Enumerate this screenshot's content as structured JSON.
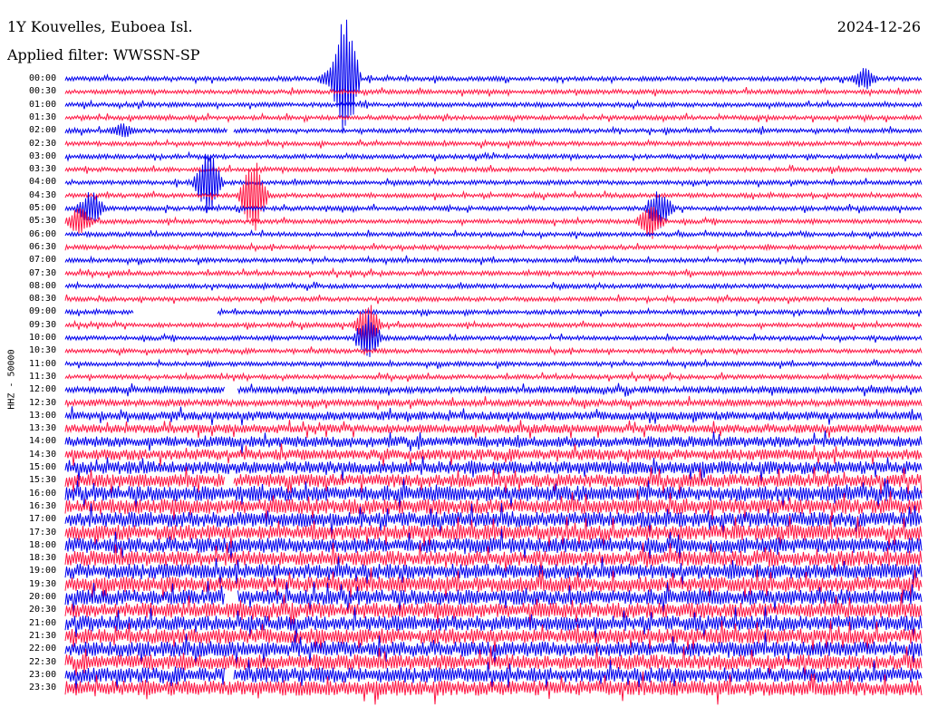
{
  "header": {
    "title": "1Y Kouvelles, Euboea Isl.",
    "date": "2024-12-26",
    "filter": "Applied filter: WWSSN-SP",
    "channel_label": "HHZ - 50000"
  },
  "colors": {
    "trace_a": "#0000ee",
    "trace_b": "#ff1744",
    "background": "#ffffff"
  },
  "chart_data": {
    "type": "line",
    "title": "1Y Kouvelles, Euboea Isl.",
    "subtitle": "Applied filter: WWSSN-SP",
    "ylabel": "HHZ - 50000",
    "row_labels": [
      "00:00",
      "00:30",
      "01:00",
      "01:30",
      "02:00",
      "02:30",
      "03:00",
      "03:30",
      "04:00",
      "04:30",
      "05:00",
      "05:30",
      "06:00",
      "06:30",
      "07:00",
      "07:30",
      "08:00",
      "08:30",
      "09:00",
      "09:30",
      "10:00",
      "10:30",
      "11:00",
      "11:30",
      "12:00",
      "12:30",
      "13:00",
      "13:30",
      "14:00",
      "14:30",
      "15:00",
      "15:30",
      "16:00",
      "16:30",
      "17:00",
      "17:30",
      "18:00",
      "18:30",
      "19:00",
      "19:30",
      "20:00",
      "20:30",
      "21:00",
      "21:30",
      "22:00",
      "22:30",
      "23:00",
      "23:30"
    ],
    "row_colors": [
      "blue",
      "red"
    ],
    "noise_level": [
      2,
      2,
      2,
      2,
      2,
      2,
      2,
      2,
      2,
      2,
      2,
      2,
      2,
      2,
      2,
      2,
      2,
      2,
      2,
      2,
      2,
      2,
      2,
      2,
      3,
      3,
      4,
      4,
      5,
      5,
      6,
      6,
      7,
      7,
      7,
      7,
      7,
      7,
      7,
      7,
      7,
      7,
      7,
      7,
      7,
      7,
      7,
      7
    ],
    "gaps": [
      {
        "row": "02:00",
        "from_min": 5.7,
        "to_min": 5.9
      },
      {
        "row": "09:00",
        "from_min": 2.4,
        "to_min": 5.3
      },
      {
        "row": "12:00",
        "from_min": 5.6,
        "to_min": 6.0
      },
      {
        "row": "15:30",
        "from_min": 5.6,
        "to_min": 5.9
      },
      {
        "row": "20:00",
        "from_min": 5.6,
        "to_min": 6.0
      },
      {
        "row": "23:00",
        "from_min": 5.6,
        "to_min": 5.9
      }
    ],
    "events": [
      {
        "row": "00:00",
        "minute": 9.3,
        "amplitude": 14
      },
      {
        "row": "00:00",
        "minute": 28.0,
        "amplitude": 14
      },
      {
        "row": "02:00",
        "minute": 2.0,
        "amplitude": 10
      },
      {
        "row": "04:00",
        "minute": 5.0,
        "amplitude": 40
      },
      {
        "row": "04:30",
        "minute": 6.6,
        "amplitude": 45
      },
      {
        "row": "05:00",
        "minute": 0.9,
        "amplitude": 22
      },
      {
        "row": "05:00",
        "minute": 20.8,
        "amplitude": 25
      },
      {
        "row": "05:30",
        "minute": 0.5,
        "amplitude": 18
      },
      {
        "row": "05:30",
        "minute": 20.5,
        "amplitude": 22
      },
      {
        "row": "09:30",
        "minute": 10.6,
        "amplitude": 30
      },
      {
        "row": "10:00",
        "minute": 10.6,
        "amplitude": 28
      },
      {
        "row": "00:00",
        "minute": 9.8,
        "amplitude": 80
      }
    ]
  }
}
